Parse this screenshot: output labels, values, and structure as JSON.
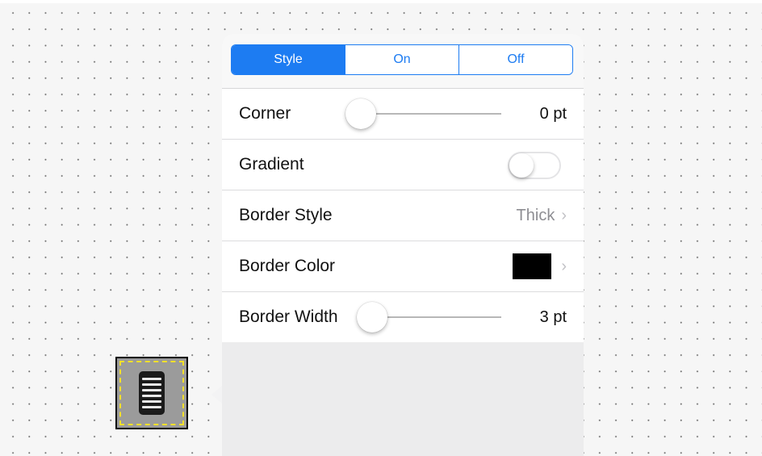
{
  "segmented_control": {
    "segments": [
      {
        "label": "Style",
        "selected": true
      },
      {
        "label": "On",
        "selected": false
      },
      {
        "label": "Off",
        "selected": false
      }
    ]
  },
  "rows": {
    "corner": {
      "label": "Corner",
      "value": "0 pt",
      "slider_fraction": 0.0
    },
    "gradient": {
      "label": "Gradient",
      "enabled": false
    },
    "border_style": {
      "label": "Border Style",
      "value": "Thick",
      "chevron": "›"
    },
    "border_color": {
      "label": "Border Color",
      "color": "#000000",
      "chevron": "›"
    },
    "border_width": {
      "label": "Border Width",
      "value": "3 pt",
      "slider_fraction": 0.08
    }
  },
  "canvas": {
    "selected_shape": {
      "icon": "server-rack-icon",
      "fill": "#9b9b9b",
      "selection_color": "#f5e12a"
    }
  },
  "colors": {
    "accent": "#1d7cf2"
  }
}
